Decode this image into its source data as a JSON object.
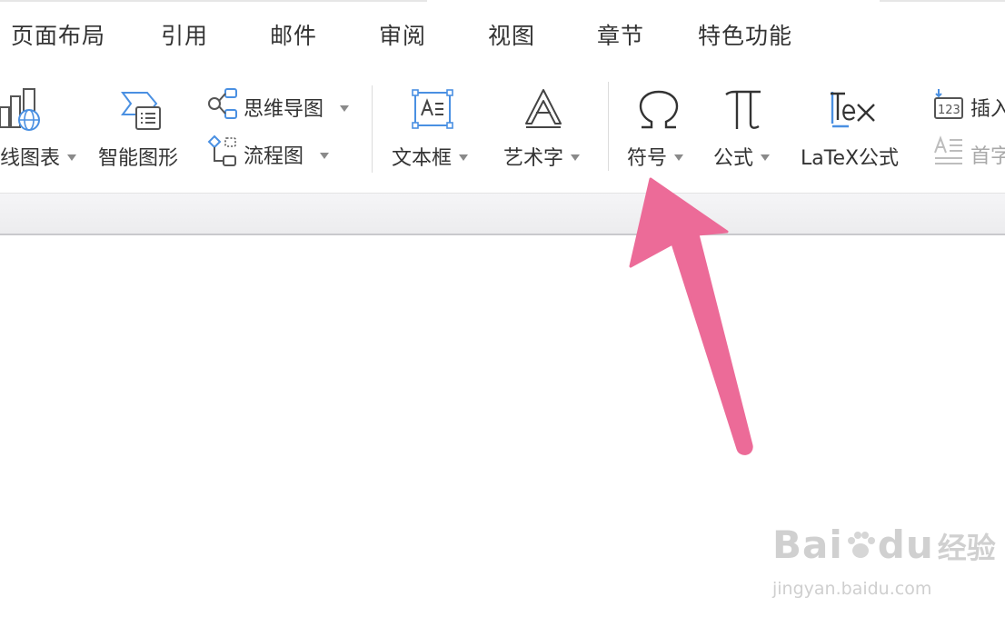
{
  "tabs": [
    "页面布局",
    "引用",
    "邮件",
    "审阅",
    "视图",
    "章节",
    "特色功能"
  ],
  "ribbon": {
    "chart_label": "线图表",
    "smart_shape_label": "智能图形",
    "mindmap_label": "思维导图",
    "flowchart_label": "流程图",
    "textbox_label": "文本框",
    "wordart_label": "艺术字",
    "symbol_label": "符号",
    "formula_label": "公式",
    "latex_label": "LaTeX公式",
    "insert_number_label": "插入",
    "dropcap_label": "首字"
  },
  "icons": {
    "symbol": "omega-icon",
    "formula": "pi-icon",
    "latex": "tex-icon"
  },
  "colors": {
    "accent_blue": "#4a90e2",
    "pointer_pink": "#ec6b98"
  },
  "watermark": {
    "brand_latin_1": "Bai",
    "brand_latin_2": "du",
    "brand_cn": "经验",
    "url": "jingyan.baidu.com"
  }
}
